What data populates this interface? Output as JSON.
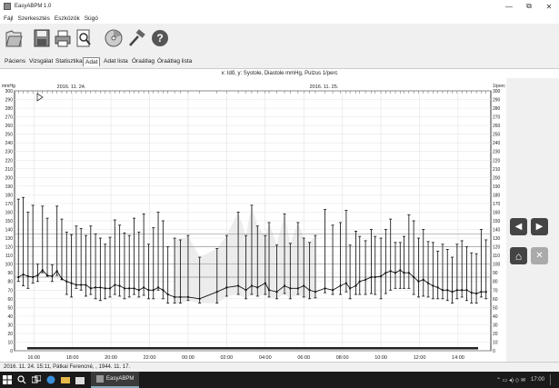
{
  "window": {
    "title": "EasyABPM 1.0",
    "minimize": "—",
    "maximize": "⧉",
    "close": "✕"
  },
  "menu": [
    "Fájl",
    "Szerkesztés",
    "Eszközök",
    "Súgó"
  ],
  "toolbar": {
    "tabs": [
      "Páciens",
      "Vizsgálat",
      "Statisztika",
      "Adat",
      "Adat lista",
      "Óraátlag",
      "Óraátlag lista"
    ],
    "active_tab": "Adat"
  },
  "chart_header": "x: Idő,  y: Systole, Diastole mmHg, Pulzus 1/perc",
  "chart_data": {
    "type": "line",
    "title": "x: Idő,  y: Systole, Diastole mmHg, Pulzus 1/perc",
    "ylabel_left": "mmHg",
    "ylabel_right": "1/perc",
    "ylim": [
      0,
      300
    ],
    "y_ticks": [
      0,
      10,
      20,
      30,
      40,
      50,
      60,
      70,
      80,
      90,
      100,
      110,
      120,
      130,
      140,
      150,
      160,
      170,
      180,
      190,
      200,
      210,
      220,
      230,
      240,
      250,
      260,
      270,
      280,
      290,
      300
    ],
    "x_ticks": [
      "16:00",
      "18:00",
      "20:00",
      "22:00",
      "00:00",
      "02:00",
      "04:00",
      "06:00",
      "08:00",
      "10:00",
      "12:00",
      "14:00"
    ],
    "date_labels": [
      "2016. 11. 24.",
      "2016. 11. 25."
    ],
    "reference_lines": [
      135,
      120,
      100,
      85
    ],
    "readings": [
      {
        "x": 15.2,
        "sys": 175,
        "dia": 80,
        "pulse": 85
      },
      {
        "x": 15.45,
        "sys": 177,
        "dia": 75,
        "pulse": 88
      },
      {
        "x": 15.7,
        "sys": 160,
        "dia": 72,
        "pulse": 86
      },
      {
        "x": 15.95,
        "sys": 168,
        "dia": 78,
        "pulse": 85
      },
      {
        "x": 16.2,
        "sys": 100,
        "dia": 80,
        "pulse": 87
      },
      {
        "x": 16.45,
        "sys": 167,
        "dia": 90,
        "pulse": 93
      },
      {
        "x": 16.7,
        "sys": 153,
        "dia": 86,
        "pulse": 87
      },
      {
        "x": 16.95,
        "sys": 99,
        "dia": 80,
        "pulse": 86
      },
      {
        "x": 17.2,
        "sys": 167,
        "dia": 87,
        "pulse": 92
      },
      {
        "x": 17.45,
        "sys": 152,
        "dia": 82,
        "pulse": 83
      },
      {
        "x": 17.7,
        "sys": 137,
        "dia": 65,
        "pulse": 80
      },
      {
        "x": 17.95,
        "sys": 134,
        "dia": 62,
        "pulse": 78
      },
      {
        "x": 18.2,
        "sys": 144,
        "dia": 72,
        "pulse": 76
      },
      {
        "x": 18.45,
        "sys": 141,
        "dia": 70,
        "pulse": 76
      },
      {
        "x": 18.7,
        "sys": 133,
        "dia": 63,
        "pulse": 76
      },
      {
        "x": 18.95,
        "sys": 144,
        "dia": 65,
        "pulse": 72
      },
      {
        "x": 19.2,
        "sys": 135,
        "dia": 60,
        "pulse": 73
      },
      {
        "x": 19.45,
        "sys": 130,
        "dia": 58,
        "pulse": 73
      },
      {
        "x": 19.7,
        "sys": 123,
        "dia": 60,
        "pulse": 72
      },
      {
        "x": 19.95,
        "sys": 131,
        "dia": 62,
        "pulse": 72
      },
      {
        "x": 20.2,
        "sys": 151,
        "dia": 65,
        "pulse": 76
      },
      {
        "x": 20.45,
        "sys": 145,
        "dia": 63,
        "pulse": 75
      },
      {
        "x": 20.7,
        "sys": 136,
        "dia": 60,
        "pulse": 72
      },
      {
        "x": 20.95,
        "sys": 133,
        "dia": 62,
        "pulse": 72
      },
      {
        "x": 21.2,
        "sys": 153,
        "dia": 65,
        "pulse": 72
      },
      {
        "x": 21.45,
        "sys": 137,
        "dia": 62,
        "pulse": 70
      },
      {
        "x": 21.7,
        "sys": 158,
        "dia": 64,
        "pulse": 73
      },
      {
        "x": 21.95,
        "sys": 123,
        "dia": 60,
        "pulse": 70
      },
      {
        "x": 22.2,
        "sys": 142,
        "dia": 60,
        "pulse": 70
      },
      {
        "x": 22.45,
        "sys": 160,
        "dia": 70,
        "pulse": 73
      },
      {
        "x": 22.7,
        "sys": 150,
        "dia": 60,
        "pulse": 70
      },
      {
        "x": 22.95,
        "sys": 120,
        "dia": 55,
        "pulse": 65
      },
      {
        "x": 23.3,
        "sys": 130,
        "dia": 55,
        "pulse": 62
      },
      {
        "x": 23.6,
        "sys": 128,
        "dia": 55,
        "pulse": 62
      },
      {
        "x": 24.0,
        "sys": 133,
        "dia": 58,
        "pulse": 62
      },
      {
        "x": 24.6,
        "sys": 108,
        "dia": 55,
        "pulse": 60
      },
      {
        "x": 25.5,
        "sys": 118,
        "dia": 55,
        "pulse": 68
      },
      {
        "x": 26.0,
        "sys": 133,
        "dia": 63,
        "pulse": 73
      },
      {
        "x": 26.6,
        "sys": 160,
        "dia": 65,
        "pulse": 75
      },
      {
        "x": 27.0,
        "sys": 133,
        "dia": 60,
        "pulse": 70
      },
      {
        "x": 27.3,
        "sys": 168,
        "dia": 65,
        "pulse": 75
      },
      {
        "x": 27.6,
        "sys": 144,
        "dia": 63,
        "pulse": 73
      },
      {
        "x": 28.0,
        "sys": 133,
        "dia": 65,
        "pulse": 78
      },
      {
        "x": 28.2,
        "sys": 148,
        "dia": 62,
        "pulse": 70
      },
      {
        "x": 28.6,
        "sys": 122,
        "dia": 60,
        "pulse": 68
      },
      {
        "x": 29.0,
        "sys": 158,
        "dia": 66,
        "pulse": 75
      },
      {
        "x": 29.3,
        "sys": 124,
        "dia": 60,
        "pulse": 72
      },
      {
        "x": 29.7,
        "sys": 148,
        "dia": 65,
        "pulse": 72
      },
      {
        "x": 30.0,
        "sys": 130,
        "dia": 62,
        "pulse": 75
      },
      {
        "x": 30.3,
        "sys": 125,
        "dia": 60,
        "pulse": 70
      },
      {
        "x": 30.6,
        "sys": 133,
        "dia": 61,
        "pulse": 68
      },
      {
        "x": 31.1,
        "sys": 163,
        "dia": 67,
        "pulse": 72
      },
      {
        "x": 31.5,
        "sys": 145,
        "dia": 65,
        "pulse": 70
      },
      {
        "x": 31.9,
        "sys": 148,
        "dia": 65,
        "pulse": 75
      },
      {
        "x": 32.2,
        "sys": 162,
        "dia": 68,
        "pulse": 78
      },
      {
        "x": 32.4,
        "sys": 122,
        "dia": 60,
        "pulse": 72
      },
      {
        "x": 32.7,
        "sys": 138,
        "dia": 65,
        "pulse": 75
      },
      {
        "x": 32.9,
        "sys": 132,
        "dia": 65,
        "pulse": 80
      },
      {
        "x": 33.2,
        "sys": 127,
        "dia": 65,
        "pulse": 82
      },
      {
        "x": 33.5,
        "sys": 140,
        "dia": 66,
        "pulse": 85
      },
      {
        "x": 33.7,
        "sys": 132,
        "dia": 65,
        "pulse": 85
      },
      {
        "x": 34.0,
        "sys": 130,
        "dia": 60,
        "pulse": 86
      },
      {
        "x": 34.25,
        "sys": 140,
        "dia": 66,
        "pulse": 90
      },
      {
        "x": 34.5,
        "sys": 152,
        "dia": 70,
        "pulse": 92
      },
      {
        "x": 34.75,
        "sys": 125,
        "dia": 72,
        "pulse": 90
      },
      {
        "x": 35.0,
        "sys": 125,
        "dia": 72,
        "pulse": 93
      },
      {
        "x": 35.2,
        "sys": 132,
        "dia": 72,
        "pulse": 90
      },
      {
        "x": 35.45,
        "sys": 157,
        "dia": 72,
        "pulse": 90
      },
      {
        "x": 35.7,
        "sys": 150,
        "dia": 65,
        "pulse": 85
      },
      {
        "x": 35.95,
        "sys": 130,
        "dia": 62,
        "pulse": 80
      },
      {
        "x": 36.2,
        "sys": 140,
        "dia": 63,
        "pulse": 82
      },
      {
        "x": 36.45,
        "sys": 126,
        "dia": 62,
        "pulse": 78
      },
      {
        "x": 36.7,
        "sys": 125,
        "dia": 60,
        "pulse": 75
      },
      {
        "x": 36.95,
        "sys": 115,
        "dia": 60,
        "pulse": 73
      },
      {
        "x": 37.2,
        "sys": 123,
        "dia": 60,
        "pulse": 70
      },
      {
        "x": 37.45,
        "sys": 117,
        "dia": 58,
        "pulse": 70
      },
      {
        "x": 37.7,
        "sys": 108,
        "dia": 55,
        "pulse": 68
      },
      {
        "x": 37.95,
        "sys": 123,
        "dia": 60,
        "pulse": 70
      },
      {
        "x": 38.2,
        "sys": 127,
        "dia": 62,
        "pulse": 70
      },
      {
        "x": 38.45,
        "sys": 120,
        "dia": 58,
        "pulse": 70
      },
      {
        "x": 38.7,
        "sys": 113,
        "dia": 55,
        "pulse": 67
      },
      {
        "x": 38.95,
        "sys": 112,
        "dia": 55,
        "pulse": 66
      },
      {
        "x": 39.2,
        "sys": 140,
        "dia": 62,
        "pulse": 68
      },
      {
        "x": 39.45,
        "sys": 128,
        "dia": 60,
        "pulse": 68
      }
    ]
  },
  "side_buttons": {
    "prev": "◀",
    "next": "▶",
    "home": "⌂",
    "close": "✕"
  },
  "status": "2016. 11. 24. 15:11, Pátkai Ferencné, , 1944. 11. 17.",
  "taskbar": {
    "app": "EasyABPM",
    "clock": "17:00",
    "tray": "⌃  ▭  ◂)  ◇  ✉",
    "search_placeholder": "",
    "icons": [
      "windows-logo",
      "search",
      "task-view",
      "edge",
      "explorer",
      "store",
      "app-indicator"
    ]
  }
}
